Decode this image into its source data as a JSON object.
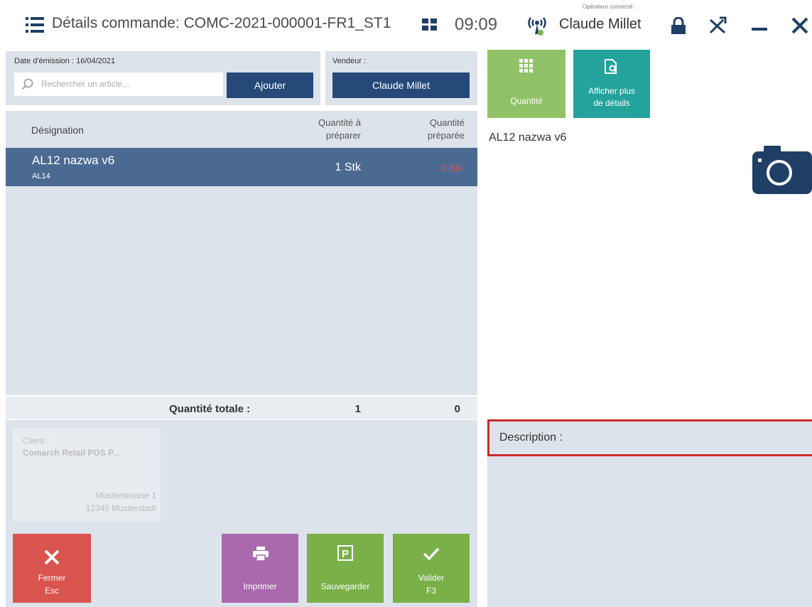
{
  "titlebar": {
    "title": "Détails commande: COMC-2021-000001-FR1_ST1",
    "time": "09:09",
    "operator_label": "Opérateur connecté :",
    "operator_name": "Claude Millet"
  },
  "header": {
    "date_label": "Date d'émission : 16/04/2021",
    "search_placeholder": "Rechercher un article...",
    "add_button": "Ajouter",
    "vendor_label": "Vendeur :",
    "vendor_value": "Claude Millet"
  },
  "list": {
    "col_designation": "Désignation",
    "col_qty_to_prepare": "Quantité à préparer",
    "col_qty_prepared": "Quantité préparée",
    "rows": [
      {
        "name": "AL12 nazwa v6",
        "code": "AL14",
        "qty_to_prepare": "1 Stk",
        "qty_prepared": "0 Stk"
      }
    ],
    "total_label": "Quantité totale :",
    "total_to_prepare": "1",
    "total_prepared": "0"
  },
  "client": {
    "label": "Client :",
    "name": "Comarch Retail POS P...",
    "street": "Musterstrasse 1",
    "city": "12345 Musterstadt"
  },
  "actions": {
    "close_label": "Fermer",
    "close_key": "Esc",
    "print_label": "Imprimer",
    "save_label": "Sauvegarder",
    "validate_label": "Valider",
    "validate_key": "F3"
  },
  "right": {
    "quantity_button": "Quantité",
    "details_button_line1": "Afficher plus",
    "details_button_line2": "de détails",
    "article_name": "AL12 nazwa v6",
    "description_label": "Description :"
  },
  "colors": {
    "navy": "#254a79",
    "selected_row": "#4b6a92",
    "panel_bg": "#dde3ea",
    "close_red": "#d9534f",
    "print_purple": "#a96aad",
    "green": "#79b048",
    "teal": "#24a39c",
    "highlight_red": "#cc2a2a"
  },
  "icons": [
    "menu-icon",
    "grid-icon",
    "signal-icon",
    "lock-icon",
    "tools-icon",
    "minimize-icon",
    "close-icon",
    "search-icon",
    "x-icon",
    "printer-icon",
    "parking-icon",
    "check-icon",
    "keypad-icon",
    "document-search-icon",
    "camera-icon"
  ]
}
